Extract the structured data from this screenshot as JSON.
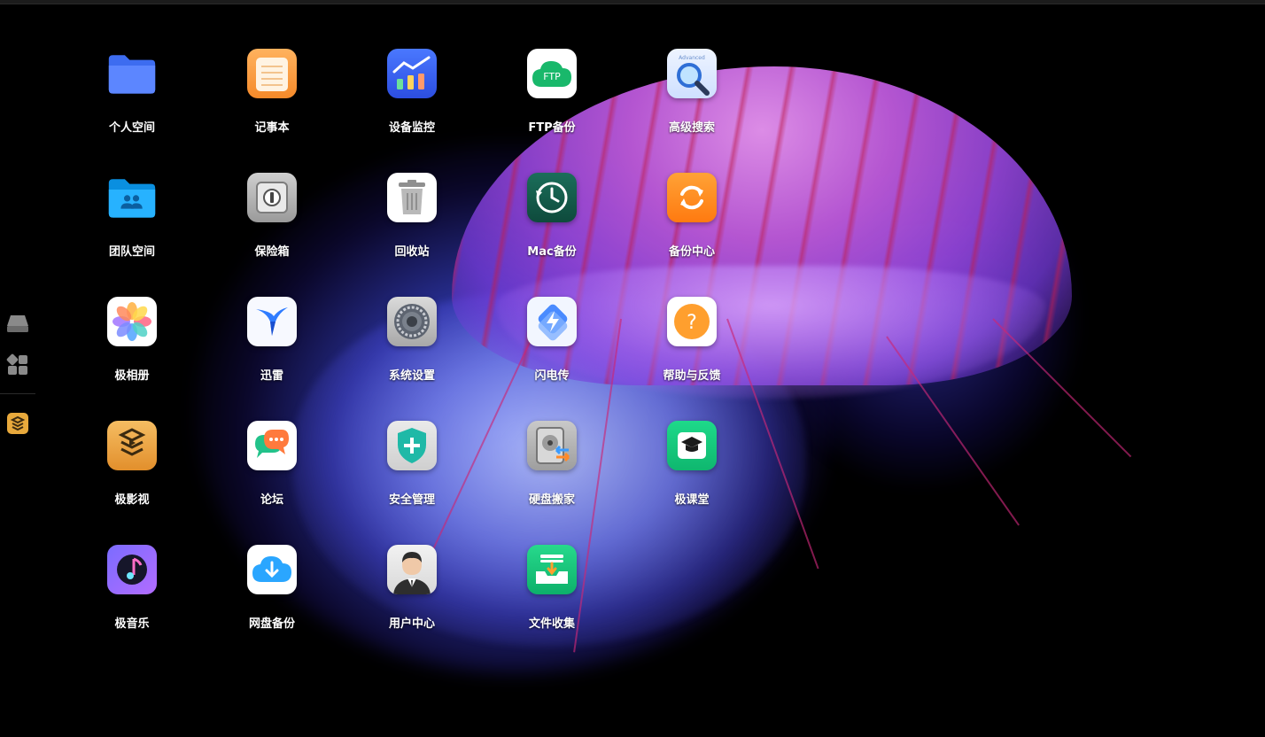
{
  "sidebar": {
    "items": [
      {
        "icon": "drive-icon"
      },
      {
        "icon": "app-grid-icon"
      },
      {
        "icon": "jiyingshi-icon"
      }
    ]
  },
  "apps": [
    {
      "label": "个人空间",
      "icon": "folder-icon"
    },
    {
      "label": "记事本",
      "icon": "notepad-icon"
    },
    {
      "label": "设备监控",
      "icon": "chart-icon"
    },
    {
      "label": "FTP备份",
      "icon": "cloud-ftp-icon",
      "badge": "FTP"
    },
    {
      "label": "高级搜索",
      "icon": "magnifier-icon",
      "badge": "Advanced"
    },
    {
      "label": "团队空间",
      "icon": "team-folder-icon"
    },
    {
      "label": "保险箱",
      "icon": "safe-icon"
    },
    {
      "label": "回收站",
      "icon": "trash-icon"
    },
    {
      "label": "Mac备份",
      "icon": "time-machine-icon"
    },
    {
      "label": "备份中心",
      "icon": "sync-icon"
    },
    {
      "label": "极相册",
      "icon": "photos-icon"
    },
    {
      "label": "迅雷",
      "icon": "thunder-bird-icon"
    },
    {
      "label": "系统设置",
      "icon": "settings-gear-icon"
    },
    {
      "label": "闪电传",
      "icon": "lightning-transfer-icon"
    },
    {
      "label": "帮助与反馈",
      "icon": "help-icon",
      "badge": "?"
    },
    {
      "label": "极影视",
      "icon": "video-icon"
    },
    {
      "label": "论坛",
      "icon": "forum-icon"
    },
    {
      "label": "安全管理",
      "icon": "shield-icon"
    },
    {
      "label": "硬盘搬家",
      "icon": "disk-migrate-icon"
    },
    {
      "label": "极课堂",
      "icon": "graduation-icon"
    },
    {
      "label": "极音乐",
      "icon": "music-icon"
    },
    {
      "label": "网盘备份",
      "icon": "cloud-download-icon"
    },
    {
      "label": "用户中心",
      "icon": "user-avatar-icon"
    },
    {
      "label": "文件收集",
      "icon": "file-collect-icon"
    }
  ]
}
